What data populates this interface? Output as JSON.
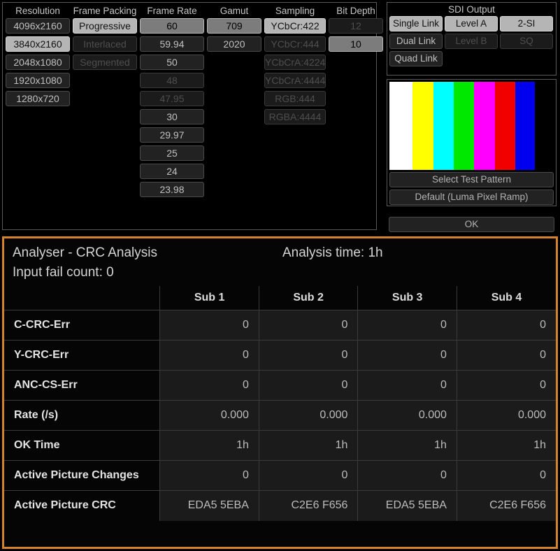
{
  "format_panel": {
    "columns": [
      {
        "header": "Resolution",
        "width_class": "w-res",
        "options": [
          {
            "label": "4096x2160",
            "state": "normal"
          },
          {
            "label": "3840x2160",
            "state": "selected-bright"
          },
          {
            "label": "2048x1080",
            "state": "normal"
          },
          {
            "label": "1920x1080",
            "state": "normal"
          },
          {
            "label": "1280x720",
            "state": "normal"
          }
        ]
      },
      {
        "header": "Frame Packing",
        "width_class": "w-pack",
        "options": [
          {
            "label": "Progressive",
            "state": "selected-bright"
          },
          {
            "label": "Interlaced",
            "state": "disabled"
          },
          {
            "label": "Segmented",
            "state": "disabled"
          }
        ]
      },
      {
        "header": "Frame Rate",
        "width_class": "w-rate",
        "options": [
          {
            "label": "60",
            "state": "selected"
          },
          {
            "label": "59.94",
            "state": "normal"
          },
          {
            "label": "50",
            "state": "normal"
          },
          {
            "label": "48",
            "state": "disabled"
          },
          {
            "label": "47.95",
            "state": "disabled"
          },
          {
            "label": "30",
            "state": "normal"
          },
          {
            "label": "29.97",
            "state": "normal"
          },
          {
            "label": "25",
            "state": "normal"
          },
          {
            "label": "24",
            "state": "normal"
          },
          {
            "label": "23.98",
            "state": "normal"
          }
        ]
      },
      {
        "header": "Gamut",
        "width_class": "w-gam",
        "options": [
          {
            "label": "709",
            "state": "selected"
          },
          {
            "label": "2020",
            "state": "normal"
          }
        ]
      },
      {
        "header": "Sampling",
        "width_class": "w-samp",
        "options": [
          {
            "label": "YCbCr:422",
            "state": "selected-bright"
          },
          {
            "label": "YCbCr:444",
            "state": "disabled"
          },
          {
            "label": "YCbCrA:4224",
            "state": "disabled"
          },
          {
            "label": "YCbCrA:4444",
            "state": "disabled"
          },
          {
            "label": "RGB:444",
            "state": "disabled"
          },
          {
            "label": "RGBA:4444",
            "state": "disabled"
          }
        ]
      },
      {
        "header": "Bit Depth",
        "width_class": "w-bit",
        "options": [
          {
            "label": "12",
            "state": "disabled"
          },
          {
            "label": "10",
            "state": "selected"
          }
        ]
      }
    ]
  },
  "sdi_output": {
    "title": "SDI Output",
    "rows": [
      [
        {
          "label": "Single Link",
          "state": "selected"
        },
        {
          "label": "Level A",
          "state": "selected"
        },
        {
          "label": "2-SI",
          "state": "selected"
        }
      ],
      [
        {
          "label": "Dual Link",
          "state": "normal"
        },
        {
          "label": "Level B",
          "state": "disabled"
        },
        {
          "label": "SQ",
          "state": "disabled"
        }
      ],
      [
        {
          "label": "Quad Link",
          "state": "normal"
        },
        {
          "label": "",
          "state": "blank"
        },
        {
          "label": "",
          "state": "blank"
        }
      ]
    ]
  },
  "test_pattern": {
    "bars": [
      {
        "name": "white",
        "color": "#ffffff",
        "width": 33
      },
      {
        "name": "yellow",
        "color": "#ffff00",
        "width": 30
      },
      {
        "name": "cyan",
        "color": "#00ffff",
        "width": 29
      },
      {
        "name": "green",
        "color": "#00e800",
        "width": 29
      },
      {
        "name": "magenta",
        "color": "#ff00ff",
        "width": 30
      },
      {
        "name": "red",
        "color": "#f20000",
        "width": 29
      },
      {
        "name": "blue",
        "color": "#0000ee",
        "width": 28
      },
      {
        "name": "black",
        "color": "#000000",
        "width": 27
      }
    ],
    "select_pattern_label": "Select Test Pattern",
    "default_pattern_label": "Default (Luma Pixel Ramp)"
  },
  "ok_button_label": "OK",
  "crc_analysis": {
    "title": "Analyser - CRC Analysis",
    "analysis_time": "Analysis time: 1h",
    "input_fail_count": "Input fail count:  0",
    "border_color": "#d4832a",
    "column_headers": [
      "",
      "Sub 1",
      "Sub 2",
      "Sub 3",
      "Sub 4"
    ],
    "rows": [
      {
        "label": "C-CRC-Err",
        "values": [
          "0",
          "0",
          "0",
          "0"
        ]
      },
      {
        "label": "Y-CRC-Err",
        "values": [
          "0",
          "0",
          "0",
          "0"
        ]
      },
      {
        "label": "ANC-CS-Err",
        "values": [
          "0",
          "0",
          "0",
          "0"
        ]
      },
      {
        "label": "Rate (/s)",
        "values": [
          "0.000",
          "0.000",
          "0.000",
          "0.000"
        ]
      },
      {
        "label": "OK Time",
        "values": [
          "1h",
          "1h",
          "1h",
          "1h"
        ]
      },
      {
        "label": "Active Picture Changes",
        "values": [
          "0",
          "0",
          "0",
          "0"
        ]
      },
      {
        "label": "Active Picture CRC",
        "values": [
          "EDA5 5EBA",
          "C2E6 F656",
          "EDA5 5EBA",
          "C2E6 F656"
        ]
      }
    ]
  }
}
